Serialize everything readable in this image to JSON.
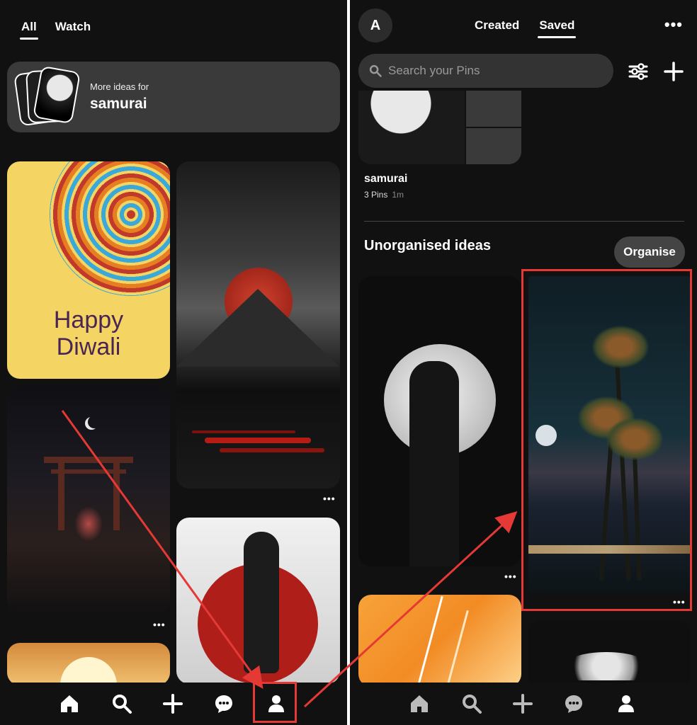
{
  "left_screen": {
    "tabs": [
      {
        "label": "All",
        "active": true
      },
      {
        "label": "Watch",
        "active": false
      }
    ],
    "more_ideas": {
      "subtitle": "More ideas for",
      "title": "samurai"
    },
    "pins": [
      {
        "name": "diwali-pin",
        "text_line1": "Happy",
        "text_line2": "Diwali"
      },
      {
        "name": "red-moon-mountain-pin"
      },
      {
        "name": "torii-gate-pin"
      },
      {
        "name": "red-sun-samurai-pin"
      },
      {
        "name": "sunset-pin"
      }
    ],
    "more_options_label": "•••",
    "nav": [
      "home-icon",
      "search-icon",
      "create-icon",
      "messages-icon",
      "profile-icon"
    ],
    "highlighted": "profile-icon"
  },
  "right_screen": {
    "avatar_letter": "A",
    "tabs": [
      {
        "label": "Created",
        "active": false
      },
      {
        "label": "Saved",
        "active": true
      }
    ],
    "more_label": "•••",
    "search": {
      "placeholder": "Search your Pins"
    },
    "board": {
      "name": "samurai",
      "pins": "3 Pins",
      "age": "1m"
    },
    "section_title": "Unorganised ideas",
    "organise_label": "Organise",
    "more_options_label": "•••",
    "pins": [
      {
        "name": "moon-samurai-pin"
      },
      {
        "name": "palm-beach-pin",
        "highlighted": true
      },
      {
        "name": "lightning-pin"
      },
      {
        "name": "white-flowers-pin"
      }
    ],
    "nav": [
      "home-icon",
      "search-icon",
      "create-icon",
      "messages-icon",
      "profile-icon"
    ],
    "active_nav": "profile-icon"
  },
  "colors": {
    "background": "#111111",
    "annotation": "#e53935",
    "card": "#3a3a3a"
  }
}
